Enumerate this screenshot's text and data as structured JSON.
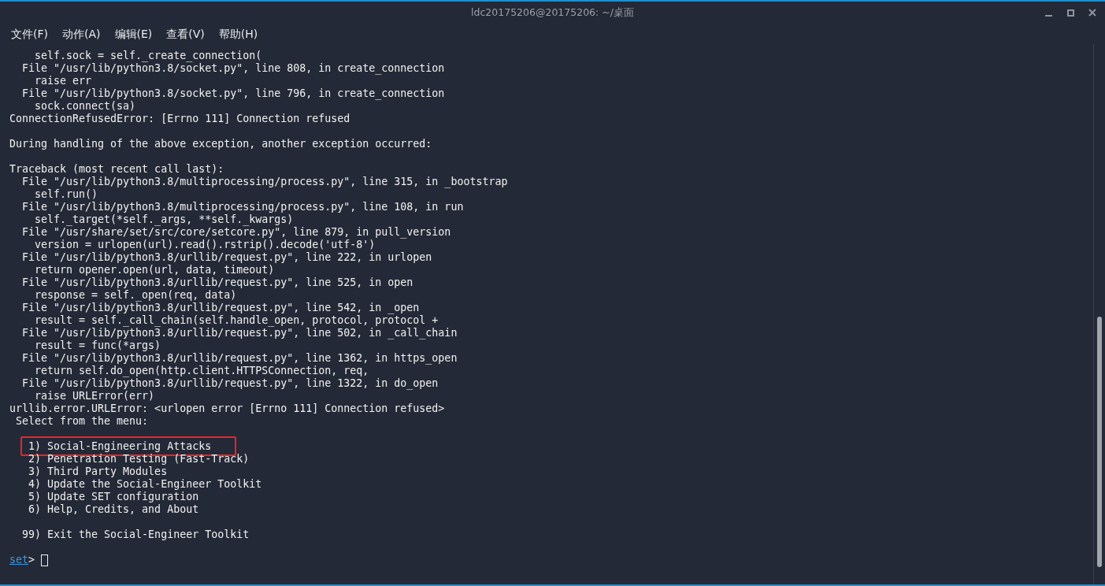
{
  "window": {
    "title": "ldc20175206@20175206: ~/桌面"
  },
  "menu": [
    "文件(F)",
    "动作(A)",
    "编辑(E)",
    "查看(V)",
    "帮助(H)"
  ],
  "terminal": {
    "lines": [
      {
        "kind": "text",
        "text": "    self.sock = self._create_connection("
      },
      {
        "kind": "text",
        "text": "  File \"/usr/lib/python3.8/socket.py\", line 808, in create_connection"
      },
      {
        "kind": "text",
        "text": "    raise err"
      },
      {
        "kind": "text",
        "text": "  File \"/usr/lib/python3.8/socket.py\", line 796, in create_connection"
      },
      {
        "kind": "text",
        "text": "    sock.connect(sa)"
      },
      {
        "kind": "text",
        "text": "ConnectionRefusedError: [Errno 111] Connection refused"
      },
      {
        "kind": "blank"
      },
      {
        "kind": "text",
        "text": "During handling of the above exception, another exception occurred:"
      },
      {
        "kind": "blank"
      },
      {
        "kind": "text",
        "text": "Traceback (most recent call last):"
      },
      {
        "kind": "text",
        "text": "  File \"/usr/lib/python3.8/multiprocessing/process.py\", line 315, in _bootstrap"
      },
      {
        "kind": "text",
        "text": "    self.run()"
      },
      {
        "kind": "text",
        "text": "  File \"/usr/lib/python3.8/multiprocessing/process.py\", line 108, in run"
      },
      {
        "kind": "text",
        "text": "    self._target(*self._args, **self._kwargs)"
      },
      {
        "kind": "text",
        "text": "  File \"/usr/share/set/src/core/setcore.py\", line 879, in pull_version"
      },
      {
        "kind": "text",
        "text": "    version = urlopen(url).read().rstrip().decode('utf-8')"
      },
      {
        "kind": "text",
        "text": "  File \"/usr/lib/python3.8/urllib/request.py\", line 222, in urlopen"
      },
      {
        "kind": "text",
        "text": "    return opener.open(url, data, timeout)"
      },
      {
        "kind": "text",
        "text": "  File \"/usr/lib/python3.8/urllib/request.py\", line 525, in open"
      },
      {
        "kind": "text",
        "text": "    response = self._open(req, data)"
      },
      {
        "kind": "text",
        "text": "  File \"/usr/lib/python3.8/urllib/request.py\", line 542, in _open"
      },
      {
        "kind": "text",
        "text": "    result = self._call_chain(self.handle_open, protocol, protocol +"
      },
      {
        "kind": "text",
        "text": "  File \"/usr/lib/python3.8/urllib/request.py\", line 502, in _call_chain"
      },
      {
        "kind": "text",
        "text": "    result = func(*args)"
      },
      {
        "kind": "text",
        "text": "  File \"/usr/lib/python3.8/urllib/request.py\", line 1362, in https_open"
      },
      {
        "kind": "text",
        "text": "    return self.do_open(http.client.HTTPSConnection, req,"
      },
      {
        "kind": "text",
        "text": "  File \"/usr/lib/python3.8/urllib/request.py\", line 1322, in do_open"
      },
      {
        "kind": "text",
        "text": "    raise URLError(err)"
      },
      {
        "kind": "text",
        "text": "urllib.error.URLError: <urlopen error [Errno 111] Connection refused>"
      },
      {
        "kind": "text",
        "text": " Select from the menu:"
      },
      {
        "kind": "blank"
      },
      {
        "kind": "text",
        "text": "   1) Social-Engineering Attacks",
        "highlighted": true
      },
      {
        "kind": "text",
        "text": "   2) Penetration Testing (Fast-Track)",
        "highlighted": false
      },
      {
        "kind": "text",
        "text": "   3) Third Party Modules",
        "highlighted": false
      },
      {
        "kind": "text",
        "text": "   4) Update the Social-Engineer Toolkit",
        "highlighted": false
      },
      {
        "kind": "text",
        "text": "   5) Update SET configuration",
        "highlighted": false
      },
      {
        "kind": "text",
        "text": "   6) Help, Credits, and About",
        "highlighted": false
      },
      {
        "kind": "blank"
      },
      {
        "kind": "text",
        "text": "  99) Exit the Social-Engineer Toolkit",
        "highlighted": false
      },
      {
        "kind": "blank"
      }
    ],
    "prompt": {
      "name": "set",
      "symbol": ">"
    }
  }
}
